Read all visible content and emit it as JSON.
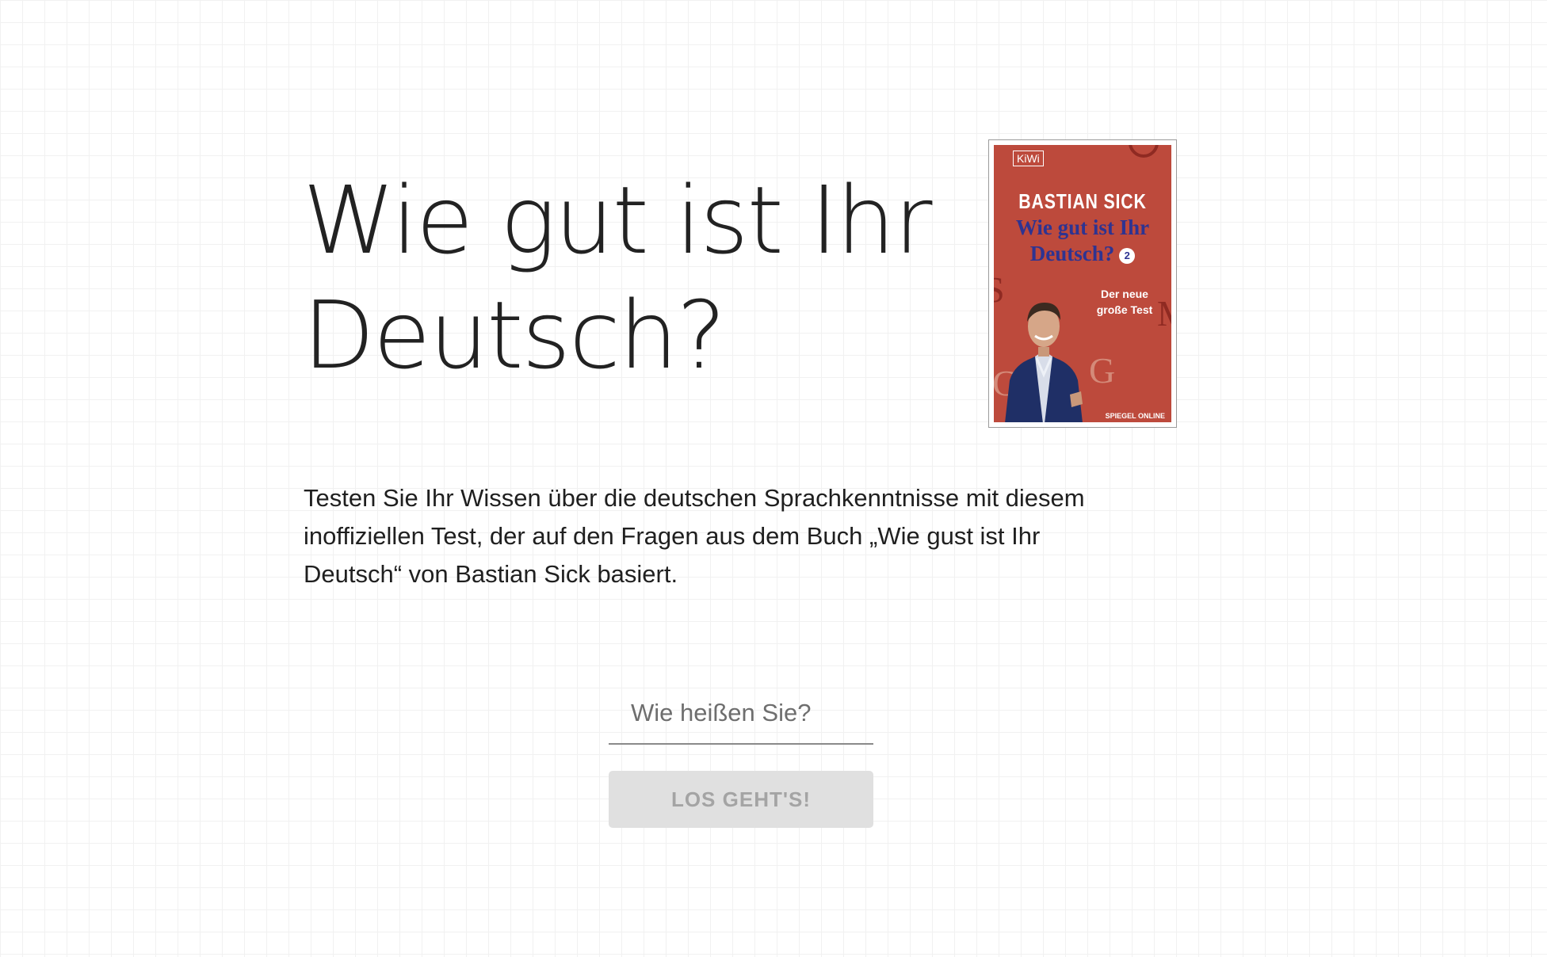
{
  "headline": {
    "line1": "Wie gut ist Ihr",
    "line2": "Deutsch?"
  },
  "book_cover": {
    "publisher": "KiWi",
    "author": "BASTIAN SICK",
    "title_line1": "Wie gut ist Ihr",
    "title_line2": "Deutsch?",
    "volume": "2",
    "subtitle_line1": "Der neue",
    "subtitle_line2": "große Test",
    "partner_logo": "SPIEGEL ONLINE",
    "cover_color": "#bd4a3c",
    "title_color": "#2e3391"
  },
  "intro": {
    "text": "Testen Sie Ihr Wissen über die deutschen Sprachkenntnisse mit diesem inoffiziellen Test, der auf den Fragen aus dem Buch „Wie gust ist Ihr Deutsch“ von Bastian Sick basiert."
  },
  "form": {
    "name_placeholder": "Wie heißen Sie?",
    "name_value": "",
    "start_label": "LOS GEHT'S!",
    "start_disabled": true
  }
}
